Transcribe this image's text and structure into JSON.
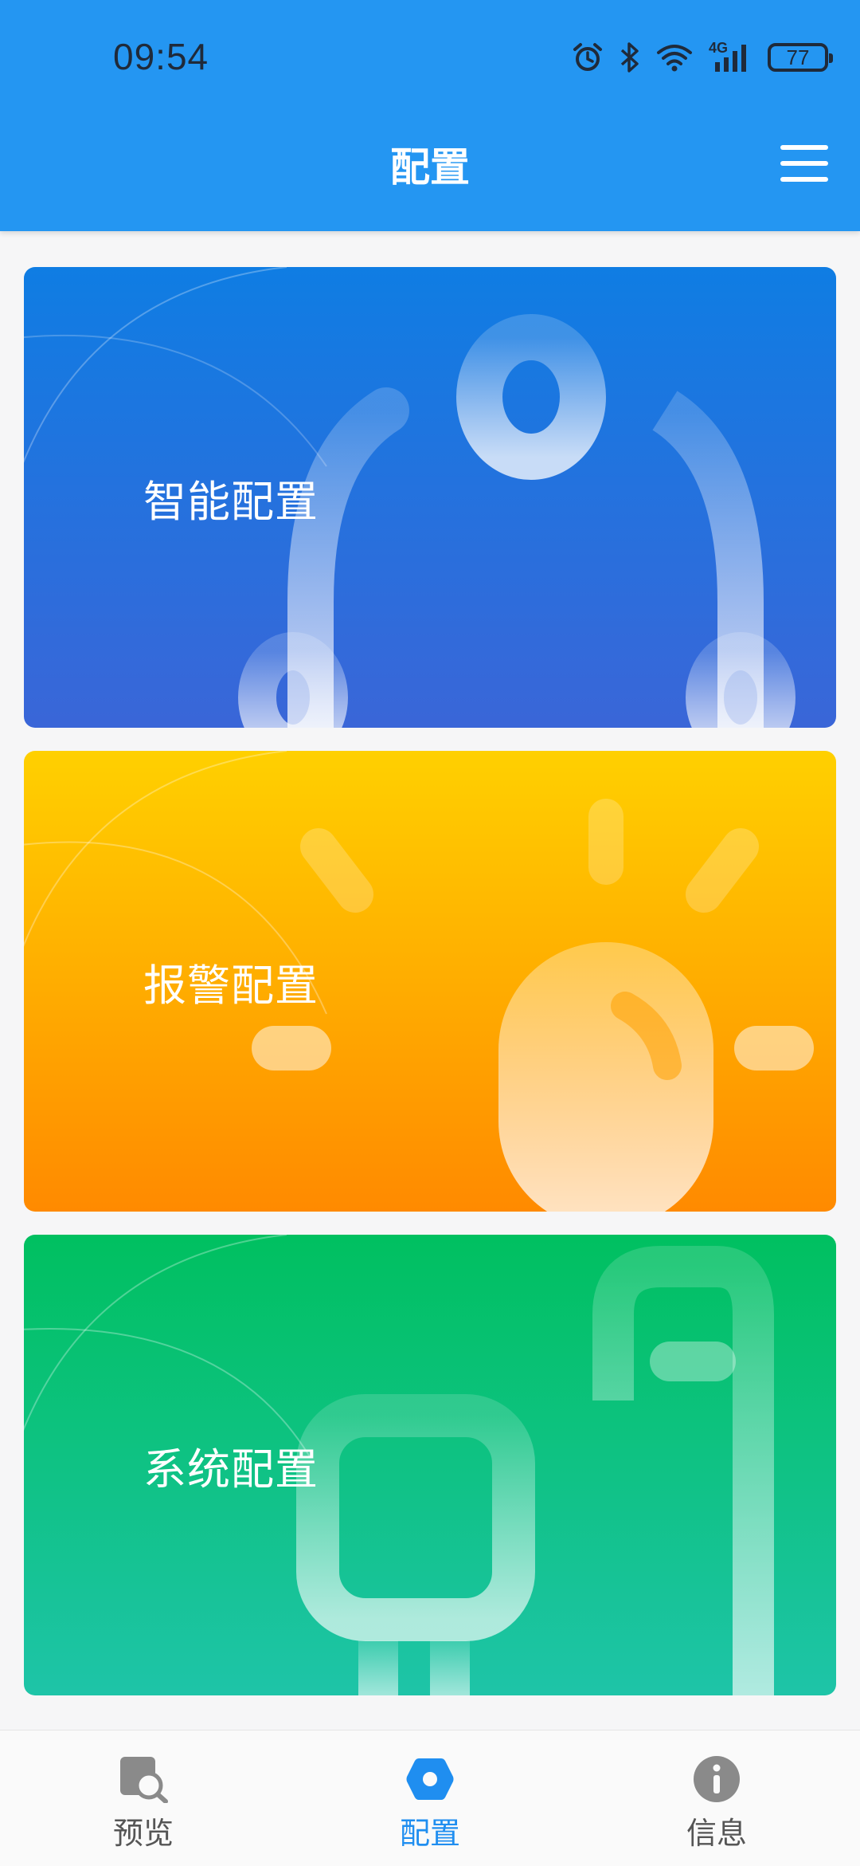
{
  "status_bar": {
    "time": "09:54",
    "network": "4G",
    "battery": "77"
  },
  "header": {
    "title": "配置"
  },
  "cards": [
    {
      "label": "智能配置",
      "icon": "network-nodes-icon"
    },
    {
      "label": "报警配置",
      "icon": "alarm-light-icon"
    },
    {
      "label": "系统配置",
      "icon": "device-plug-icon"
    }
  ],
  "tabbar": {
    "tabs": [
      {
        "label": "预览",
        "icon": "preview-search-icon",
        "active": false
      },
      {
        "label": "配置",
        "icon": "config-hexagon-icon",
        "active": true
      },
      {
        "label": "信息",
        "icon": "info-icon",
        "active": false
      }
    ]
  },
  "colors": {
    "header": "#2496f2",
    "active_tab": "#1f8ef0",
    "inactive_tab": "#555555",
    "card_blue": "#1f73e0",
    "card_yellow": "#ffb000",
    "card_green": "#10c27a"
  }
}
